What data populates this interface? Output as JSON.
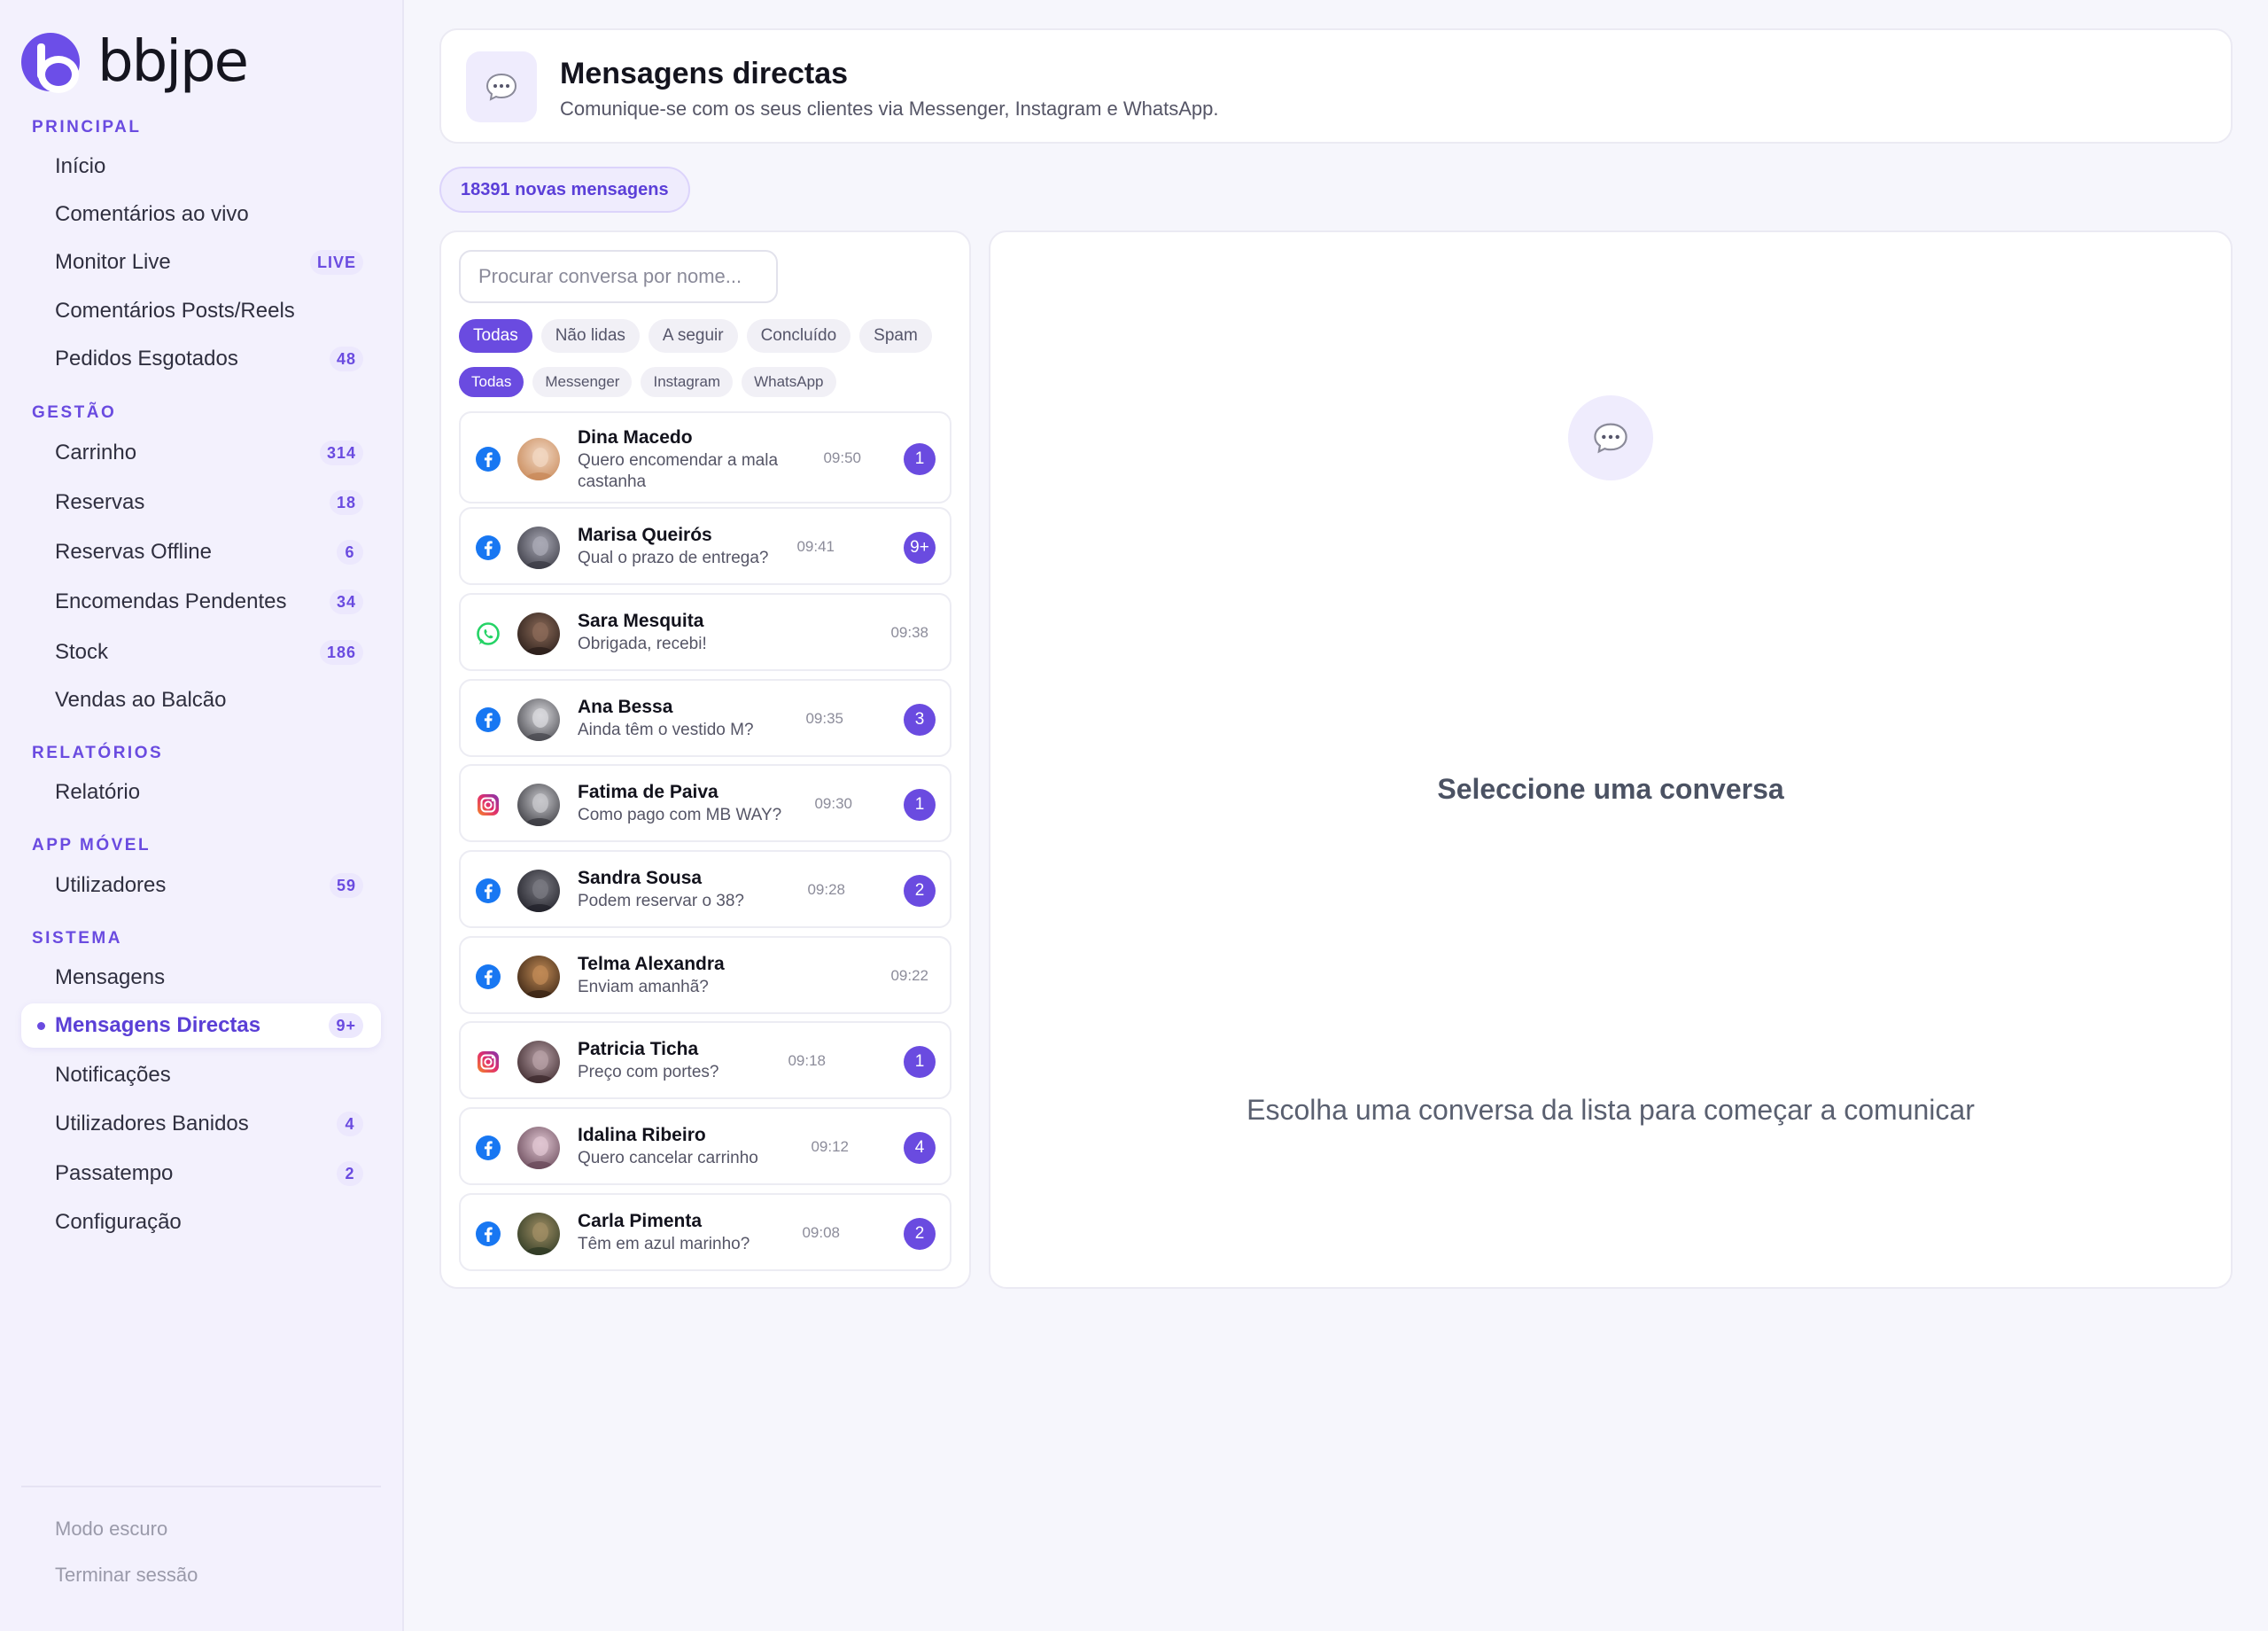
{
  "brand": {
    "name": "bbjpe"
  },
  "sidebar": {
    "sections": {
      "principal": "PRINCIPAL",
      "gestao": "GESTÃO",
      "relatorios": "RELATÓRIOS",
      "app_movel": "APP MÓVEL",
      "sistema": "SISTEMA"
    },
    "items": {
      "inicio": {
        "label": "Início"
      },
      "comentarios_ao_vivo": {
        "label": "Comentários ao vivo"
      },
      "monitor_live": {
        "label": "Monitor Live",
        "badge": "LIVE"
      },
      "comentarios_posts": {
        "label": "Comentários Posts/Reels"
      },
      "pedidos_esgotados": {
        "label": "Pedidos Esgotados",
        "badge": "48"
      },
      "carrinho": {
        "label": "Carrinho",
        "badge": "314"
      },
      "reservas": {
        "label": "Reservas",
        "badge": "18"
      },
      "reservas_offline": {
        "label": "Reservas Offline",
        "badge": "6"
      },
      "encomendas_pendentes": {
        "label": "Encomendas Pendentes",
        "badge": "34"
      },
      "stock": {
        "label": "Stock",
        "badge": "186"
      },
      "vendas_balcao": {
        "label": "Vendas ao Balcão"
      },
      "relatorio": {
        "label": "Relatório"
      },
      "utilizadores": {
        "label": "Utilizadores",
        "badge": "59"
      },
      "mensagens": {
        "label": "Mensagens"
      },
      "mensagens_directas": {
        "label": "Mensagens Directas",
        "badge": "9+"
      },
      "notificacoes": {
        "label": "Notificações"
      },
      "utilizadores_banidos": {
        "label": "Utilizadores Banidos",
        "badge": "4"
      },
      "passatempo": {
        "label": "Passatempo",
        "badge": "2"
      },
      "configuracao": {
        "label": "Configuração"
      }
    },
    "footer": {
      "dark_mode": "Modo escuro",
      "logout": "Terminar sessão"
    }
  },
  "header": {
    "title": "Mensagens directas",
    "subtitle": "Comunique-se com os seus clientes via Messenger, Instagram e WhatsApp."
  },
  "new_messages": "18391 novas mensagens",
  "search": {
    "placeholder": "Procurar conversa por nome..."
  },
  "status_filters": [
    "Todas",
    "Não lidas",
    "A seguir",
    "Concluído",
    "Spam"
  ],
  "platform_filters": [
    "Todas",
    "Messenger",
    "Instagram",
    "WhatsApp"
  ],
  "conversations": [
    {
      "platform": "messenger",
      "name": "Dina Macedo",
      "preview": "Quero encomendar a mala castanha",
      "time": "09:50",
      "unread": "1"
    },
    {
      "platform": "messenger",
      "name": "Marisa Queirós",
      "preview": "Qual o prazo de entrega?",
      "time": "09:41",
      "unread": "9+"
    },
    {
      "platform": "whatsapp",
      "name": "Sara Mesquita",
      "preview": "Obrigada, recebi!",
      "time": "09:38",
      "unread": ""
    },
    {
      "platform": "messenger",
      "name": "Ana Bessa",
      "preview": "Ainda têm o vestido M?",
      "time": "09:35",
      "unread": "3"
    },
    {
      "platform": "instagram",
      "name": "Fatima de Paiva",
      "preview": "Como pago com MB WAY?",
      "time": "09:30",
      "unread": "1"
    },
    {
      "platform": "messenger",
      "name": "Sandra Sousa",
      "preview": "Podem reservar o 38?",
      "time": "09:28",
      "unread": "2"
    },
    {
      "platform": "messenger",
      "name": "Telma Alexandra",
      "preview": "Enviam amanhã?",
      "time": "09:22",
      "unread": ""
    },
    {
      "platform": "instagram",
      "name": "Patricia Ticha",
      "preview": "Preço com portes?",
      "time": "09:18",
      "unread": "1"
    },
    {
      "platform": "messenger",
      "name": "Idalina Ribeiro",
      "preview": "Quero cancelar carrinho",
      "time": "09:12",
      "unread": "4"
    },
    {
      "platform": "messenger",
      "name": "Carla Pimenta",
      "preview": "Têm em azul marinho?",
      "time": "09:08",
      "unread": "2"
    }
  ],
  "detail": {
    "title": "Seleccione uma conversa",
    "subtitle": "Escolha uma conversa da lista para começar a comunicar"
  },
  "colors": {
    "accent": "#6a4be0",
    "messenger": "#1877f2",
    "whatsapp": "#25d366",
    "instagram": "#e1306c"
  }
}
